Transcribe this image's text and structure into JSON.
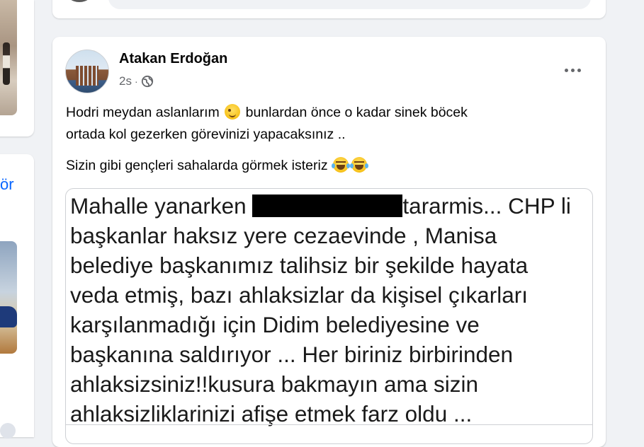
{
  "sidebar_fragment": {
    "link_text": "ör"
  },
  "post": {
    "author": "Atakan Erdoğan",
    "time": "2s",
    "separator": "·",
    "audience_icon": "globe-icon",
    "more_icon": "more-horizontal-icon",
    "paragraphs": [
      {
        "before": "Hodri meydan aslanlarım",
        "emoji": "winking-face",
        "after": "bunlardan önce o kadar sinek böcek"
      },
      {
        "line": "ortada kol  gezerken görevinizi yapacaksınız .."
      },
      {
        "line": "Sizin gibi gençleri sahalarda görmek isteriz",
        "emoji": "face-with-tears-of-joy x2"
      }
    ],
    "shared_image": {
      "lines": [
        {
          "before": "Mahalle yanarken",
          "after": "tararmis... CHP li"
        },
        "başkanlar haksız yere cezaevinde , Manisa",
        "belediye başkanımız talihsiz bir şekilde hayata",
        "veda etmiş, bazı ahlaksizlar da kişisel çıkarları",
        "karşılanmadığı için Didim belediyesine ve",
        "başkanına saldırıyor ... Her biriniz birbirinden",
        "ahlaksizsiniz!!kusura bakmayın ama sizin",
        "ahlaksizliklarinizi afişe etmek farz oldu ..."
      ]
    }
  },
  "colors": {
    "link": "#0866ff",
    "secondary_text": "#65676b",
    "background": "#f0f2f5"
  }
}
